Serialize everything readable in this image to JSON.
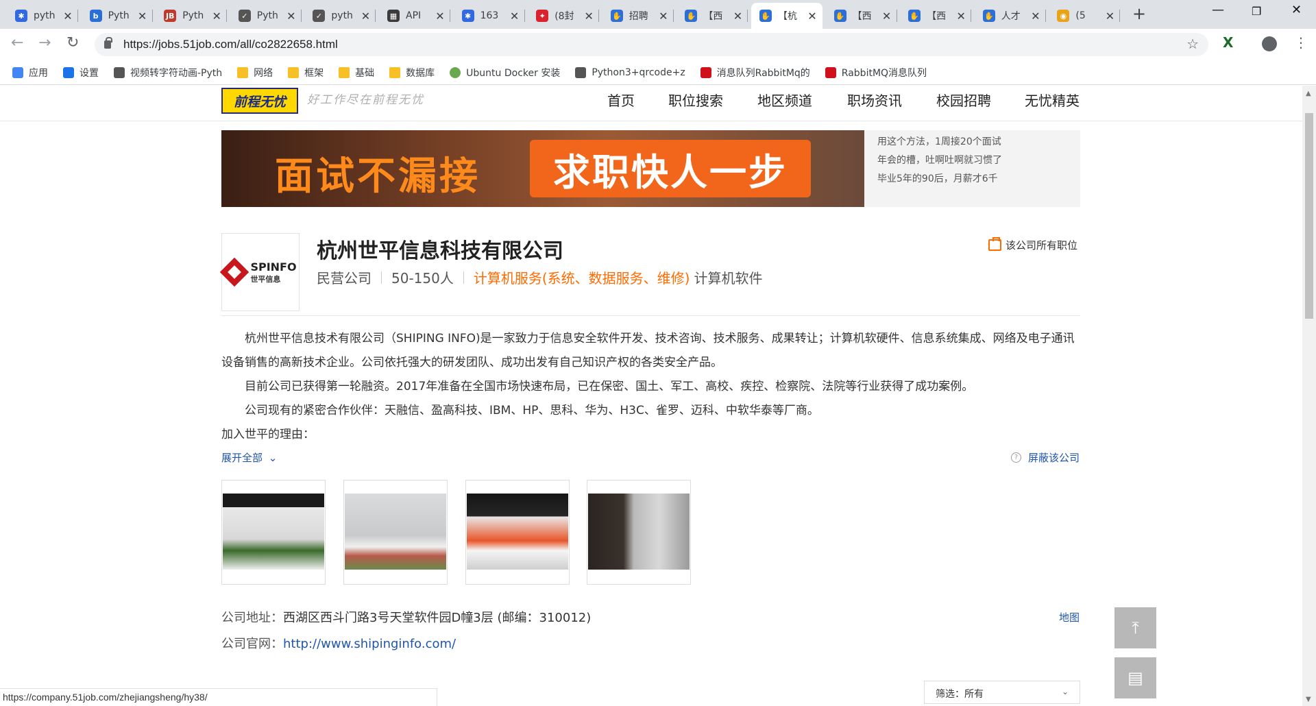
{
  "browser": {
    "tabs": [
      {
        "title": "pyth",
        "icon": "baidu-icon",
        "color": "#3268e0"
      },
      {
        "title": "Pyth",
        "icon": "bing-b-icon",
        "color": "#2a6ed8"
      },
      {
        "title": "Pyth",
        "icon": "jb-icon",
        "color": "#c0392b"
      },
      {
        "title": "Pyth",
        "icon": "csdn-icon",
        "color": "#555555"
      },
      {
        "title": "pyth",
        "icon": "csdn-icon",
        "color": "#555555"
      },
      {
        "title": "API",
        "icon": "doc-icon",
        "color": "#3b3b3b"
      },
      {
        "title": "163",
        "icon": "baidu-icon",
        "color": "#3268e0"
      },
      {
        "title": "(8封",
        "icon": "mail-icon",
        "color": "#d9232d"
      },
      {
        "title": "招聘",
        "icon": "hand-icon",
        "color": "#2d6fd9"
      },
      {
        "title": "【西",
        "icon": "hand-icon",
        "color": "#2d6fd9"
      },
      {
        "title": "【杭",
        "icon": "hand-icon",
        "color": "#2d6fd9",
        "active": true
      },
      {
        "title": "【西",
        "icon": "hand-icon",
        "color": "#2d6fd9"
      },
      {
        "title": "【西",
        "icon": "hand-icon",
        "color": "#2d6fd9"
      },
      {
        "title": "人才",
        "icon": "hand-icon",
        "color": "#2d6fd9"
      },
      {
        "title": "(5",
        "icon": "chrome-icon",
        "color": "#e8a319"
      }
    ],
    "url": "https://jobs.51job.com/all/co2822658.html",
    "bookmarks": [
      {
        "label": "应用",
        "icon": "apps-grid-icon"
      },
      {
        "label": "设置",
        "icon": "gear-icon"
      },
      {
        "label": "视频转字符动画-Pyth",
        "icon": "csdn-icon"
      },
      {
        "label": "网络",
        "icon": "folder-icon"
      },
      {
        "label": "框架",
        "icon": "folder-icon"
      },
      {
        "label": "基础",
        "icon": "folder-icon"
      },
      {
        "label": "数据库",
        "icon": "folder-icon"
      },
      {
        "label": "Ubuntu Docker 安装",
        "icon": "ubuntu-icon"
      },
      {
        "label": "Python3+qrcode+z",
        "icon": "csdn-icon"
      },
      {
        "label": "消息队列RabbitMq的",
        "icon": "red-c-icon"
      },
      {
        "label": "RabbitMQ消息队列",
        "icon": "red-c-icon"
      }
    ],
    "status_url": "https://company.51job.com/zhejiangsheng/hy38/"
  },
  "site": {
    "logo_text": "前程无忧",
    "slogan": "好工作尽在前程无忧",
    "nav": [
      "首页",
      "职位搜索",
      "地区频道",
      "职场资讯",
      "校园招聘",
      "无忧精英"
    ]
  },
  "banner": {
    "left_text": "面试不漏接",
    "right_text": "求职快人一步",
    "side_lines": [
      "用这个方法，1周接20个面试",
      "年会的槽，吐啊吐啊就习惯了",
      "毕业5年的90后，月薪才6千"
    ]
  },
  "company": {
    "logo_en": "SPINFO",
    "logo_cn": "世平信息",
    "name": "杭州世平信息科技有限公司",
    "type": "民营公司",
    "size": "50-150人",
    "industry": "计算机服务(系统、数据服务、维修)",
    "industry2": "计算机软件",
    "all_jobs_label": "该公司所有职位",
    "intro": [
      "杭州世平信息技术有限公司（SHIPING INFO)是一家致力于信息安全软件开发、技术咨询、技术服务、成果转让；计算机软硬件、信息系统集成、网络及电子通讯设备销售的高新技术企业。公司依托强大的研发团队、成功出发有自己知识产权的各类安全产品。",
      "目前公司已获得第一轮融资。2017年准备在全国市场快速布局，已在保密、国土、军工、高校、疾控、检察院、法院等行业获得了成功案例。",
      "公司现有的紧密合作伙伴：天融信、盈高科技、IBM、HP、思科、华为、H3C、雀罗、迈科、中软华泰等厂商。",
      "加入世平的理由："
    ],
    "expand_label": "展开全部",
    "block_label": "屏蔽该公司",
    "address_label": "公司地址：",
    "address": "西湖区西斗门路3号天堂软件园D幢3层 (邮编：310012)",
    "map_label": "地图",
    "website_label": "公司官网：",
    "website": "http://www.shipinginfo.com/",
    "filter_label": "筛选：",
    "filter_value": "所有"
  }
}
